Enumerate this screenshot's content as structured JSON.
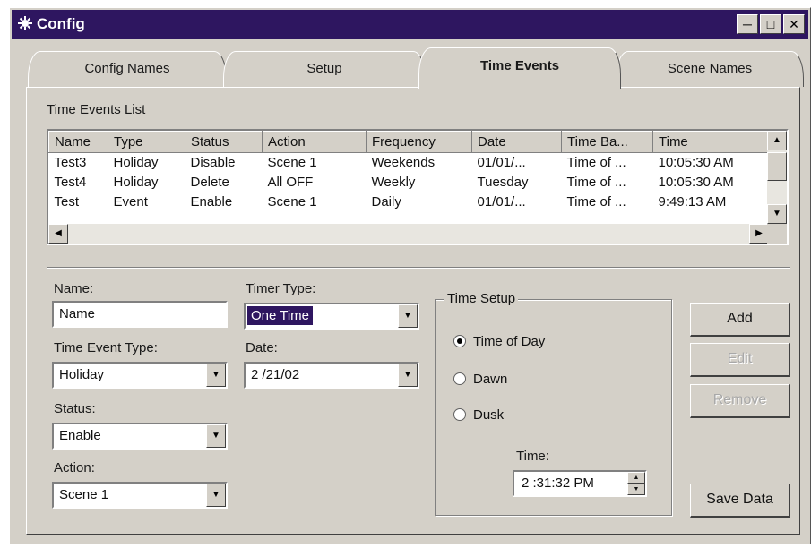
{
  "window": {
    "title": "Config"
  },
  "tabs": [
    {
      "label": "Config Names"
    },
    {
      "label": "Setup"
    },
    {
      "label": "Time Events"
    },
    {
      "label": "Scene Names"
    }
  ],
  "active_tab": "Time Events",
  "list": {
    "label": "Time Events List",
    "columns": [
      "Name",
      "Type",
      "Status",
      "Action",
      "Frequency",
      "Date",
      "Time Ba...",
      "Time"
    ],
    "rows": [
      [
        "Test3",
        "Holiday",
        "Disable",
        "Scene 1",
        "Weekends",
        "01/01/...",
        "Time of ...",
        "10:05:30 AM"
      ],
      [
        "Test4",
        "Holiday",
        "Delete",
        "All OFF",
        "Weekly",
        "Tuesday",
        "Time of ...",
        "10:05:30 AM"
      ],
      [
        "Test",
        "Event",
        "Enable",
        "Scene 1",
        "Daily",
        "01/01/...",
        "Time of ...",
        "9:49:13 AM"
      ]
    ]
  },
  "form": {
    "name_label": "Name:",
    "name_value": "Name",
    "event_type_label": "Time Event Type:",
    "event_type_value": "Holiday",
    "status_label": "Status:",
    "status_value": "Enable",
    "action_label": "Action:",
    "action_value": "Scene 1",
    "timer_type_label": "Timer Type:",
    "timer_type_value": "One Time",
    "date_label": "Date:",
    "date_value": "2 /21/02"
  },
  "time_setup": {
    "label": "Time Setup",
    "options": [
      {
        "label": "Time of Day",
        "selected": true
      },
      {
        "label": "Dawn",
        "selected": false
      },
      {
        "label": "Dusk",
        "selected": false
      }
    ],
    "time_label": "Time:",
    "time_value": "2 :31:32 PM"
  },
  "buttons": {
    "add": "Add",
    "edit": "Edit",
    "remove": "Remove",
    "save": "Save Data"
  },
  "colors": {
    "titlebar": "#2e1660",
    "face": "#d4d0c8",
    "selection": "#2e1660"
  }
}
